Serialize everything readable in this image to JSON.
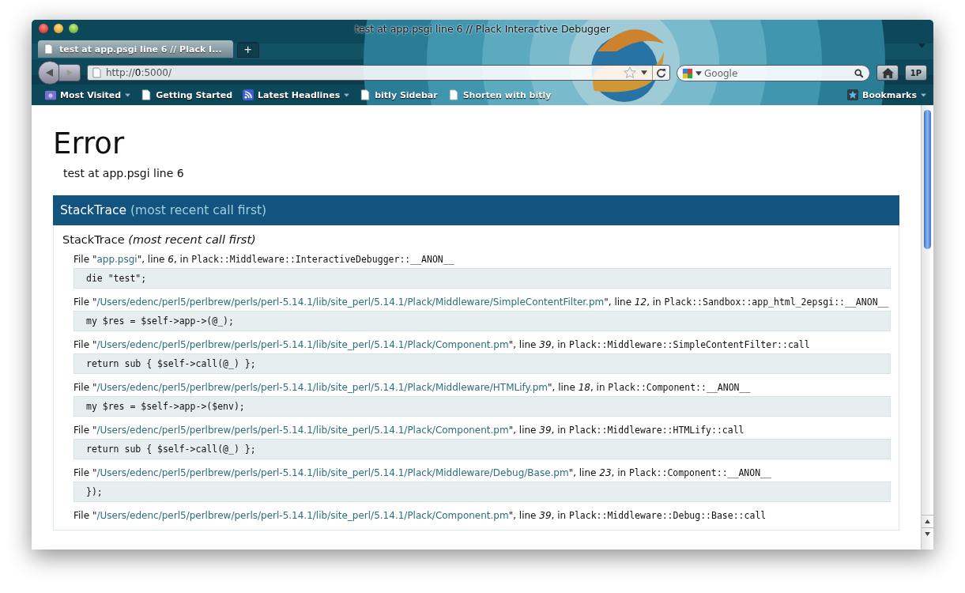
{
  "window": {
    "title": "test at app.psgi line 6 // Plack Interactive Debugger"
  },
  "tabs": [
    {
      "label": "test at app.psgi line 6 // Plack I...",
      "selected": true
    }
  ],
  "new_tab": "+",
  "address_bar": {
    "value": "http://**0**:5000/"
  },
  "search": {
    "placeholder": "Google"
  },
  "toolbar_buttons": [
    {
      "kind": "home"
    },
    {
      "kind": "text",
      "label": "1P"
    }
  ],
  "bookmarks": [
    {
      "label": "Most Visited",
      "kind": "folder",
      "menu": true
    },
    {
      "label": "Getting Started",
      "kind": "page",
      "menu": false
    },
    {
      "label": "Latest Headlines",
      "kind": "feed",
      "menu": true
    },
    {
      "label": "bitly Sidebar",
      "kind": "page",
      "menu": false
    },
    {
      "label": "Shorten with bitly",
      "kind": "page",
      "menu": false
    }
  ],
  "bookmarks_menu": {
    "label": "Bookmarks"
  },
  "page": {
    "heading": "Error",
    "message": "test at app.psgi line 6",
    "bar": {
      "title": "StackTrace",
      "note": "(most recent call first)"
    },
    "panel": {
      "title": "StackTrace",
      "note": "(most recent call first)"
    },
    "frames": [
      {
        "prefix": "File \"",
        "file": "app.psgi",
        "line_label": "\", line",
        "line": "6",
        "in_label": ", in",
        "sub": "Plack::Middleware::InteractiveDebugger::__ANON__",
        "code": "die \"test\";"
      },
      {
        "prefix": "File \"",
        "file": "/Users/edenc/perl5/perlbrew/perls/perl-5.14.1/lib/site_perl/5.14.1/Plack/Middleware/SimpleContentFilter.pm",
        "line_label": "\", line",
        "line": "12",
        "in_label": ", in",
        "sub": "Plack::Sandbox::app_html_2epsgi::__ANON__",
        "code": "my $res = $self->app->(@_);"
      },
      {
        "prefix": "File \"",
        "file": "/Users/edenc/perl5/perlbrew/perls/perl-5.14.1/lib/site_perl/5.14.1/Plack/Component.pm",
        "line_label": "\", line",
        "line": "39",
        "in_label": ", in",
        "sub": "Plack::Middleware::SimpleContentFilter::call",
        "code": "return sub { $self->call(@_) };"
      },
      {
        "prefix": "File \"",
        "file": "/Users/edenc/perl5/perlbrew/perls/perl-5.14.1/lib/site_perl/5.14.1/Plack/Middleware/HTMLify.pm",
        "line_label": "\", line",
        "line": "18",
        "in_label": ", in",
        "sub": "Plack::Component::__ANON__",
        "code": "my $res = $self->app->($env);"
      },
      {
        "prefix": "File \"",
        "file": "/Users/edenc/perl5/perlbrew/perls/perl-5.14.1/lib/site_perl/5.14.1/Plack/Component.pm",
        "line_label": "\", line",
        "line": "39",
        "in_label": ", in",
        "sub": "Plack::Middleware::HTMLify::call",
        "code": "return sub { $self->call(@_) };"
      },
      {
        "prefix": "File \"",
        "file": "/Users/edenc/perl5/perlbrew/perls/perl-5.14.1/lib/site_perl/5.14.1/Plack/Middleware/Debug/Base.pm",
        "line_label": "\", line",
        "line": "23",
        "in_label": ", in",
        "sub": "Plack::Component::__ANON__",
        "code": "});"
      },
      {
        "prefix": "File \"",
        "file": "/Users/edenc/perl5/perlbrew/perls/perl-5.14.1/lib/site_perl/5.14.1/Plack/Component.pm",
        "line_label": "\", line",
        "line": "39",
        "in_label": ", in",
        "sub": "Plack::Middleware::Debug::Base::call"
      }
    ]
  }
}
